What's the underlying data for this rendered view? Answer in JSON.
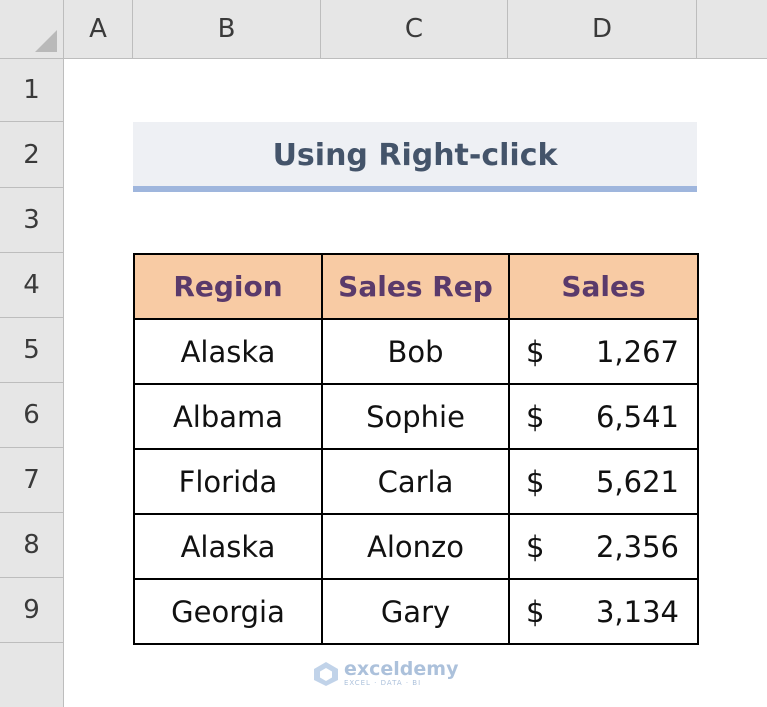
{
  "columns": [
    "A",
    "B",
    "C",
    "D"
  ],
  "rows": [
    "1",
    "2",
    "3",
    "4",
    "5",
    "6",
    "7",
    "8",
    "9"
  ],
  "title": "Using Right-click",
  "table": {
    "headers": [
      "Region",
      "Sales Rep",
      "Sales"
    ],
    "rows": [
      {
        "region": "Alaska",
        "rep": "Bob",
        "currency": "$",
        "sales": "1,267"
      },
      {
        "region": "Albama",
        "rep": "Sophie",
        "currency": "$",
        "sales": "6,541"
      },
      {
        "region": "Florida",
        "rep": "Carla",
        "currency": "$",
        "sales": "5,621"
      },
      {
        "region": "Alaska",
        "rep": "Alonzo",
        "currency": "$",
        "sales": "2,356"
      },
      {
        "region": "Georgia",
        "rep": "Gary",
        "currency": "$",
        "sales": "3,134"
      }
    ]
  },
  "watermark": {
    "name": "exceldemy",
    "tagline": "EXCEL · DATA · BI"
  },
  "colors": {
    "header_fill": "#f8cba4",
    "title_fill": "#eef0f4",
    "title_text": "#44546a",
    "underline": "#9fb6dd"
  }
}
